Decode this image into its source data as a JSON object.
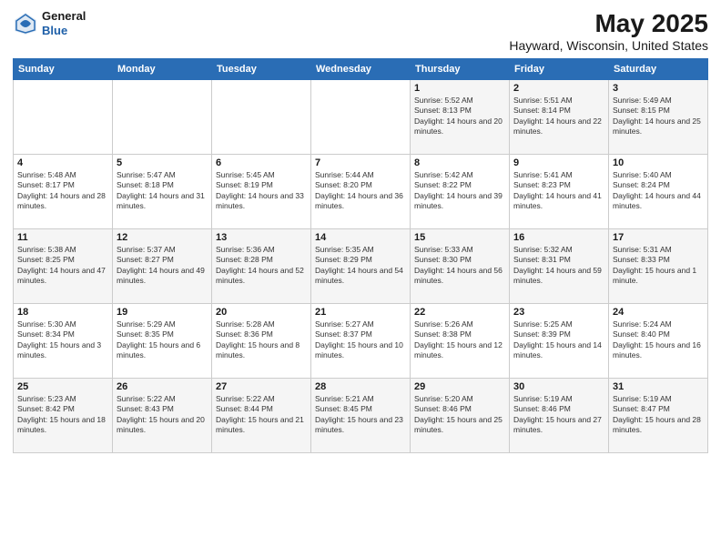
{
  "header": {
    "logo_general": "General",
    "logo_blue": "Blue",
    "title": "May 2025",
    "subtitle": "Hayward, Wisconsin, United States"
  },
  "days_of_week": [
    "Sunday",
    "Monday",
    "Tuesday",
    "Wednesday",
    "Thursday",
    "Friday",
    "Saturday"
  ],
  "weeks": [
    [
      {
        "day": "",
        "sunrise": "",
        "sunset": "",
        "daylight": ""
      },
      {
        "day": "",
        "sunrise": "",
        "sunset": "",
        "daylight": ""
      },
      {
        "day": "",
        "sunrise": "",
        "sunset": "",
        "daylight": ""
      },
      {
        "day": "",
        "sunrise": "",
        "sunset": "",
        "daylight": ""
      },
      {
        "day": "1",
        "sunrise": "Sunrise: 5:52 AM",
        "sunset": "Sunset: 8:13 PM",
        "daylight": "Daylight: 14 hours and 20 minutes."
      },
      {
        "day": "2",
        "sunrise": "Sunrise: 5:51 AM",
        "sunset": "Sunset: 8:14 PM",
        "daylight": "Daylight: 14 hours and 22 minutes."
      },
      {
        "day": "3",
        "sunrise": "Sunrise: 5:49 AM",
        "sunset": "Sunset: 8:15 PM",
        "daylight": "Daylight: 14 hours and 25 minutes."
      }
    ],
    [
      {
        "day": "4",
        "sunrise": "Sunrise: 5:48 AM",
        "sunset": "Sunset: 8:17 PM",
        "daylight": "Daylight: 14 hours and 28 minutes."
      },
      {
        "day": "5",
        "sunrise": "Sunrise: 5:47 AM",
        "sunset": "Sunset: 8:18 PM",
        "daylight": "Daylight: 14 hours and 31 minutes."
      },
      {
        "day": "6",
        "sunrise": "Sunrise: 5:45 AM",
        "sunset": "Sunset: 8:19 PM",
        "daylight": "Daylight: 14 hours and 33 minutes."
      },
      {
        "day": "7",
        "sunrise": "Sunrise: 5:44 AM",
        "sunset": "Sunset: 8:20 PM",
        "daylight": "Daylight: 14 hours and 36 minutes."
      },
      {
        "day": "8",
        "sunrise": "Sunrise: 5:42 AM",
        "sunset": "Sunset: 8:22 PM",
        "daylight": "Daylight: 14 hours and 39 minutes."
      },
      {
        "day": "9",
        "sunrise": "Sunrise: 5:41 AM",
        "sunset": "Sunset: 8:23 PM",
        "daylight": "Daylight: 14 hours and 41 minutes."
      },
      {
        "day": "10",
        "sunrise": "Sunrise: 5:40 AM",
        "sunset": "Sunset: 8:24 PM",
        "daylight": "Daylight: 14 hours and 44 minutes."
      }
    ],
    [
      {
        "day": "11",
        "sunrise": "Sunrise: 5:38 AM",
        "sunset": "Sunset: 8:25 PM",
        "daylight": "Daylight: 14 hours and 47 minutes."
      },
      {
        "day": "12",
        "sunrise": "Sunrise: 5:37 AM",
        "sunset": "Sunset: 8:27 PM",
        "daylight": "Daylight: 14 hours and 49 minutes."
      },
      {
        "day": "13",
        "sunrise": "Sunrise: 5:36 AM",
        "sunset": "Sunset: 8:28 PM",
        "daylight": "Daylight: 14 hours and 52 minutes."
      },
      {
        "day": "14",
        "sunrise": "Sunrise: 5:35 AM",
        "sunset": "Sunset: 8:29 PM",
        "daylight": "Daylight: 14 hours and 54 minutes."
      },
      {
        "day": "15",
        "sunrise": "Sunrise: 5:33 AM",
        "sunset": "Sunset: 8:30 PM",
        "daylight": "Daylight: 14 hours and 56 minutes."
      },
      {
        "day": "16",
        "sunrise": "Sunrise: 5:32 AM",
        "sunset": "Sunset: 8:31 PM",
        "daylight": "Daylight: 14 hours and 59 minutes."
      },
      {
        "day": "17",
        "sunrise": "Sunrise: 5:31 AM",
        "sunset": "Sunset: 8:33 PM",
        "daylight": "Daylight: 15 hours and 1 minute."
      }
    ],
    [
      {
        "day": "18",
        "sunrise": "Sunrise: 5:30 AM",
        "sunset": "Sunset: 8:34 PM",
        "daylight": "Daylight: 15 hours and 3 minutes."
      },
      {
        "day": "19",
        "sunrise": "Sunrise: 5:29 AM",
        "sunset": "Sunset: 8:35 PM",
        "daylight": "Daylight: 15 hours and 6 minutes."
      },
      {
        "day": "20",
        "sunrise": "Sunrise: 5:28 AM",
        "sunset": "Sunset: 8:36 PM",
        "daylight": "Daylight: 15 hours and 8 minutes."
      },
      {
        "day": "21",
        "sunrise": "Sunrise: 5:27 AM",
        "sunset": "Sunset: 8:37 PM",
        "daylight": "Daylight: 15 hours and 10 minutes."
      },
      {
        "day": "22",
        "sunrise": "Sunrise: 5:26 AM",
        "sunset": "Sunset: 8:38 PM",
        "daylight": "Daylight: 15 hours and 12 minutes."
      },
      {
        "day": "23",
        "sunrise": "Sunrise: 5:25 AM",
        "sunset": "Sunset: 8:39 PM",
        "daylight": "Daylight: 15 hours and 14 minutes."
      },
      {
        "day": "24",
        "sunrise": "Sunrise: 5:24 AM",
        "sunset": "Sunset: 8:40 PM",
        "daylight": "Daylight: 15 hours and 16 minutes."
      }
    ],
    [
      {
        "day": "25",
        "sunrise": "Sunrise: 5:23 AM",
        "sunset": "Sunset: 8:42 PM",
        "daylight": "Daylight: 15 hours and 18 minutes."
      },
      {
        "day": "26",
        "sunrise": "Sunrise: 5:22 AM",
        "sunset": "Sunset: 8:43 PM",
        "daylight": "Daylight: 15 hours and 20 minutes."
      },
      {
        "day": "27",
        "sunrise": "Sunrise: 5:22 AM",
        "sunset": "Sunset: 8:44 PM",
        "daylight": "Daylight: 15 hours and 21 minutes."
      },
      {
        "day": "28",
        "sunrise": "Sunrise: 5:21 AM",
        "sunset": "Sunset: 8:45 PM",
        "daylight": "Daylight: 15 hours and 23 minutes."
      },
      {
        "day": "29",
        "sunrise": "Sunrise: 5:20 AM",
        "sunset": "Sunset: 8:46 PM",
        "daylight": "Daylight: 15 hours and 25 minutes."
      },
      {
        "day": "30",
        "sunrise": "Sunrise: 5:19 AM",
        "sunset": "Sunset: 8:46 PM",
        "daylight": "Daylight: 15 hours and 27 minutes."
      },
      {
        "day": "31",
        "sunrise": "Sunrise: 5:19 AM",
        "sunset": "Sunset: 8:47 PM",
        "daylight": "Daylight: 15 hours and 28 minutes."
      }
    ]
  ]
}
